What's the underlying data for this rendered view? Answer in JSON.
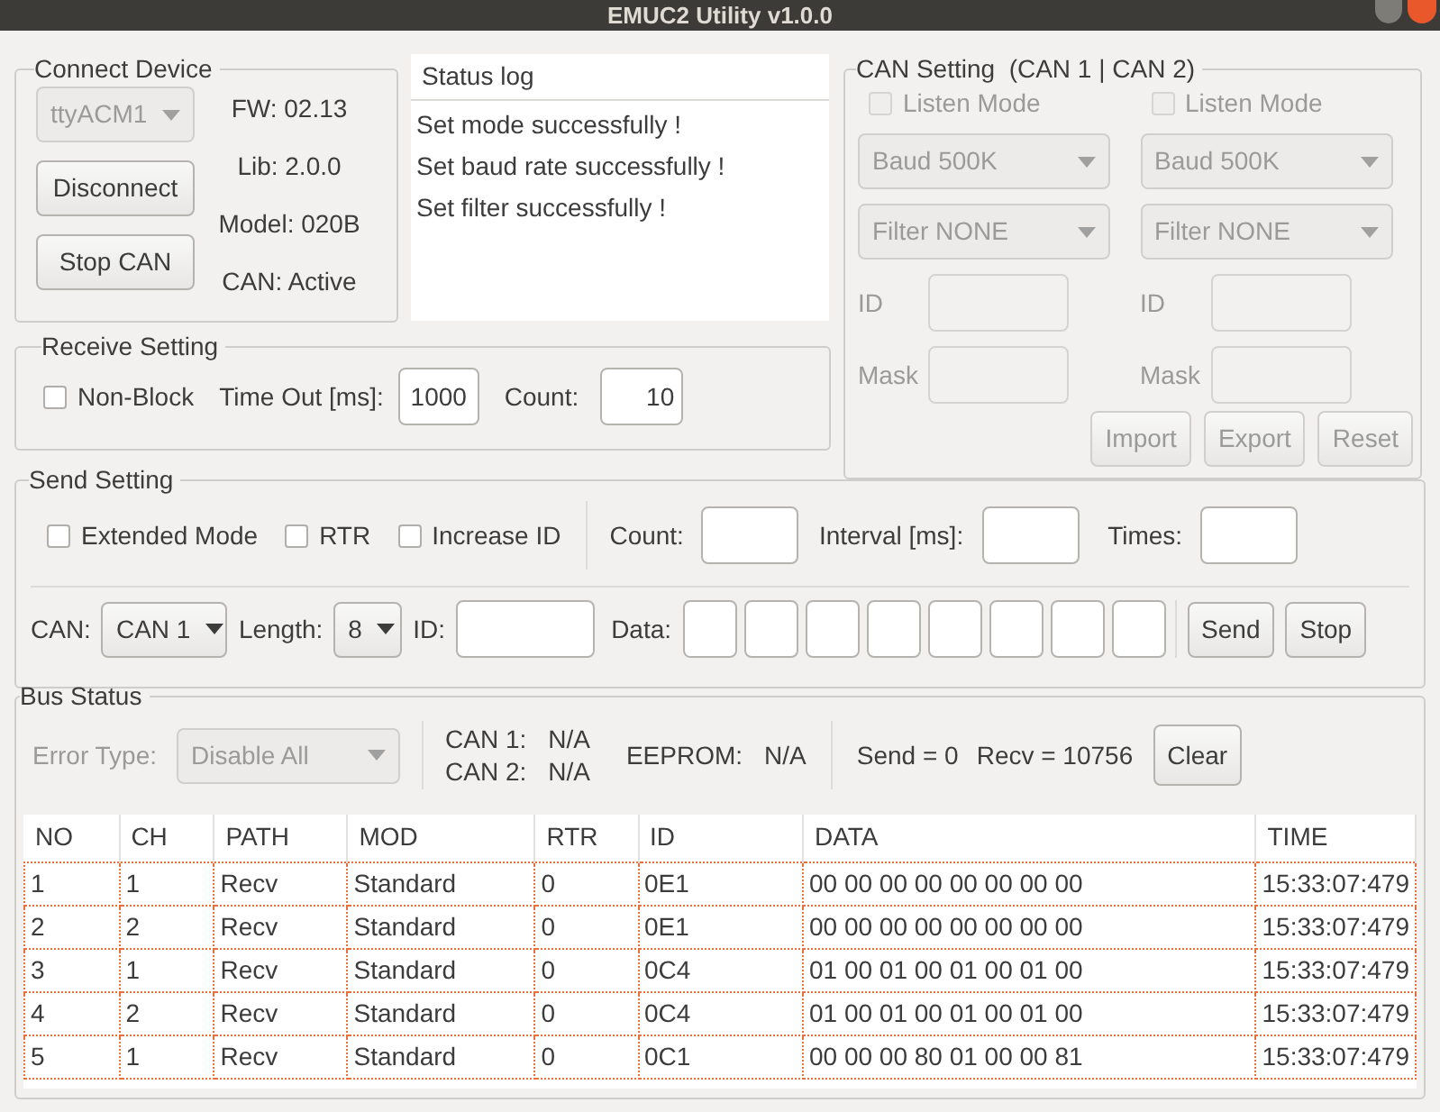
{
  "window": {
    "title": "EMUC2 Utility v1.0.0"
  },
  "connect_device": {
    "title": "Connect Device",
    "port": {
      "value": "ttyACM1",
      "disabled": true
    },
    "buttons": [
      "Disconnect",
      "Stop CAN"
    ],
    "info": [
      "FW: 02.13",
      "Lib: 2.0.0",
      "Model: 020B",
      "CAN: Active"
    ]
  },
  "status_log": {
    "title": "Status log",
    "lines": [
      "Set mode successfully !",
      "Set baud rate successfully !",
      "Set filter successfully !"
    ]
  },
  "can_setting": {
    "title": "CAN Setting  (CAN 1 | CAN 2)",
    "disabled": true,
    "channels": [
      {
        "listen_mode": {
          "label": "Listen Mode",
          "checked": false
        },
        "baud": "Baud 500K",
        "filter": "Filter NONE",
        "id_label": "ID",
        "mask_label": "Mask"
      },
      {
        "listen_mode": {
          "label": "Listen Mode",
          "checked": false
        },
        "baud": "Baud 500K",
        "filter": "Filter NONE",
        "id_label": "ID",
        "mask_label": "Mask"
      }
    ],
    "buttons": [
      "Import",
      "Export",
      "Reset"
    ]
  },
  "receive_setting": {
    "title": "Receive Setting",
    "non_block": {
      "label": "Non-Block",
      "checked": false
    },
    "timeout_label": "Time Out [ms]:",
    "timeout": "1000",
    "count_label": "Count:",
    "count": "10"
  },
  "send_setting": {
    "title": "Send Setting",
    "options": [
      {
        "label": "Extended Mode",
        "checked": false
      },
      {
        "label": "RTR",
        "checked": false
      },
      {
        "label": "Increase ID",
        "checked": false
      }
    ],
    "count_label": "Count:",
    "interval_label": "Interval [ms]:",
    "times_label": "Times:",
    "can_label": "CAN:",
    "can": "CAN 1",
    "length_label": "Length:",
    "length": "8",
    "id_label": "ID:",
    "data_label": "Data:",
    "buttons": [
      "Send",
      "Stop"
    ]
  },
  "bus_status": {
    "title": "Bus Status",
    "error_type_label": "Error Type:",
    "error_type": {
      "value": "Disable All",
      "disabled": true
    },
    "can1_label": "CAN 1:",
    "can1_value": "N/A",
    "can2_label": "CAN 2:",
    "can2_value": "N/A",
    "eeprom_label": "EEPROM:",
    "eeprom_value": "N/A",
    "send": "Send = 0",
    "recv": "Recv = 10756",
    "clear": "Clear"
  },
  "table": {
    "columns": [
      "NO",
      "CH",
      "PATH",
      "MOD",
      "RTR",
      "ID",
      "DATA",
      "TIME"
    ],
    "rows": [
      [
        "1",
        "1",
        "Recv",
        "Standard",
        "0",
        "0E1",
        "00 00 00 00 00 00 00 00",
        "15:33:07:479"
      ],
      [
        "2",
        "2",
        "Recv",
        "Standard",
        "0",
        "0E1",
        "00 00 00 00 00 00 00 00",
        "15:33:07:479"
      ],
      [
        "3",
        "1",
        "Recv",
        "Standard",
        "0",
        "0C4",
        "01 00 01 00 01 00 01 00",
        "15:33:07:479"
      ],
      [
        "4",
        "2",
        "Recv",
        "Standard",
        "0",
        "0C4",
        "01 00 01 00 01 00 01 00",
        "15:33:07:479"
      ],
      [
        "5",
        "1",
        "Recv",
        "Standard",
        "0",
        "0C1",
        "00 00 00 80 01 00 00 81",
        "15:33:07:479"
      ]
    ]
  }
}
